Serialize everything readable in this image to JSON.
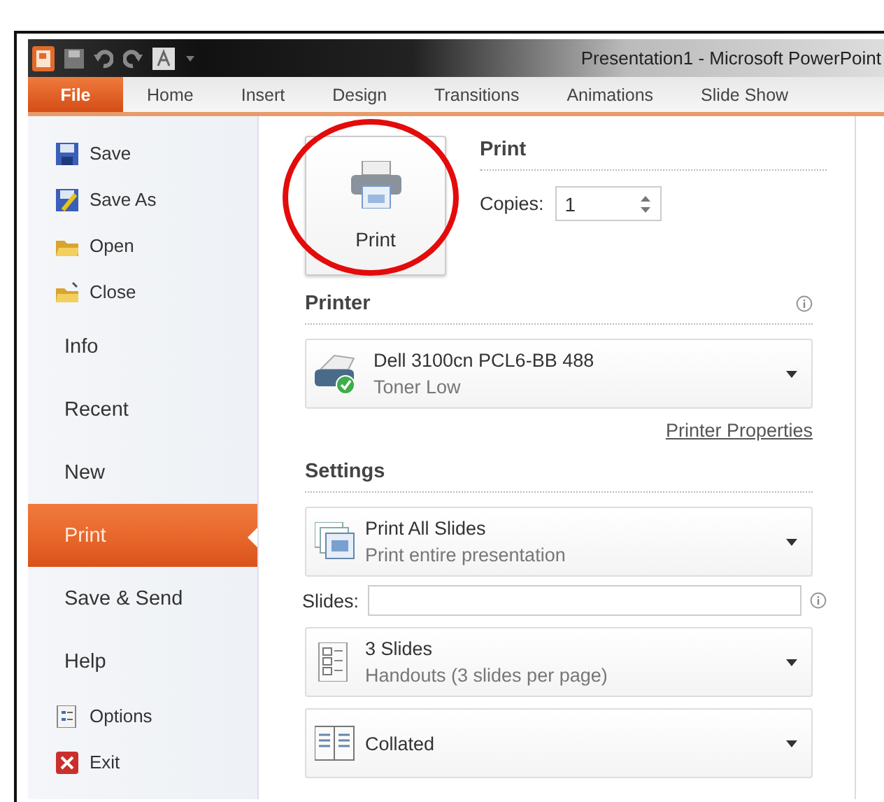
{
  "window": {
    "title": "Presentation1  -  Microsoft PowerPoint"
  },
  "ribbon_tabs": [
    {
      "label": "File",
      "selected": true
    },
    {
      "label": "Home",
      "selected": false
    },
    {
      "label": "Insert",
      "selected": false
    },
    {
      "label": "Design",
      "selected": false
    },
    {
      "label": "Transitions",
      "selected": false
    },
    {
      "label": "Animations",
      "selected": false
    },
    {
      "label": "Slide Show",
      "selected": false
    }
  ],
  "sidebar": {
    "items": [
      {
        "label": "Save",
        "kind": "command",
        "selected": false
      },
      {
        "label": "Save As",
        "kind": "command",
        "selected": false
      },
      {
        "label": "Open",
        "kind": "command",
        "selected": false
      },
      {
        "label": "Close",
        "kind": "command",
        "selected": false
      },
      {
        "label": "Info",
        "kind": "page",
        "selected": false
      },
      {
        "label": "Recent",
        "kind": "page",
        "selected": false
      },
      {
        "label": "New",
        "kind": "page",
        "selected": false
      },
      {
        "label": "Print",
        "kind": "page",
        "selected": true
      },
      {
        "label": "Save & Send",
        "kind": "page",
        "selected": false
      },
      {
        "label": "Help",
        "kind": "page",
        "selected": false
      },
      {
        "label": "Options",
        "kind": "command",
        "selected": false
      },
      {
        "label": "Exit",
        "kind": "command",
        "selected": false
      }
    ]
  },
  "print_section": {
    "heading": "Print",
    "button_label": "Print",
    "copies_label": "Copies:",
    "copies_value": "1"
  },
  "printer_section": {
    "heading": "Printer",
    "printer": {
      "name": "Dell 3100cn PCL6-BB 488",
      "status": "Toner Low"
    },
    "properties_link": "Printer Properties"
  },
  "settings_section": {
    "heading": "Settings",
    "items": [
      {
        "kind": "dropdown",
        "title": "Print All Slides",
        "subtitle": "Print entire presentation"
      },
      {
        "kind": "field",
        "label": "Slides:"
      },
      {
        "kind": "dropdown",
        "title": "3 Slides",
        "subtitle": "Handouts (3 slides per page)"
      },
      {
        "kind": "dropdown",
        "title": "Collated"
      }
    ]
  },
  "annotations": [
    {
      "kind": "circle"
    }
  ]
}
